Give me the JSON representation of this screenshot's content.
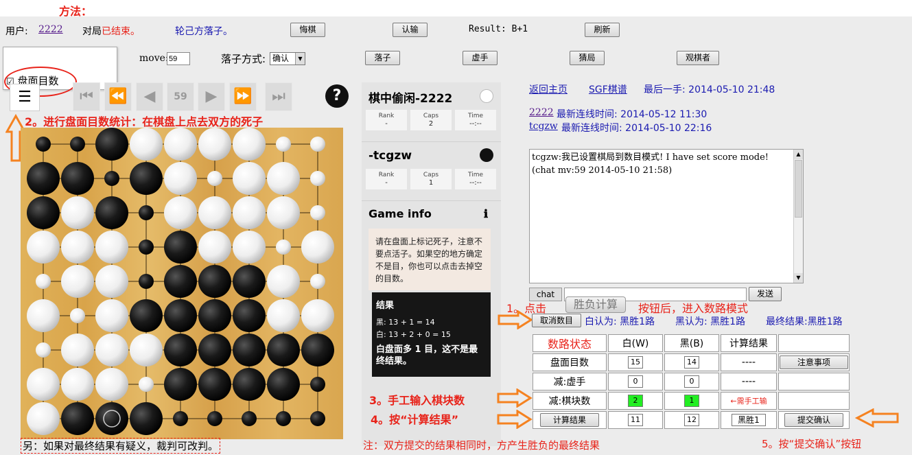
{
  "annotations": {
    "method": "方法：",
    "step2": "2。进行盘面目数统计：在棋盘上点去双方的死子",
    "step1_a": "1。点击",
    "step1_btn": "胜负计算",
    "step1_b": "按钮后，进入数路模式",
    "step3": "3。手工输入棋块数",
    "step4": "4。按“计算结果”",
    "step5": "5。按“提交确认”按钮",
    "note": "注：双方提交的结果相同时，方产生胜负的最终结果",
    "other": "另：如果对最终结果有疑义，裁判可改判。",
    "need_manual": "←需手工输"
  },
  "topbar": {
    "user_label": "用户:",
    "user_name": "2222",
    "game_status_a": "对局",
    "game_status_b": "已结束。",
    "turn": "轮己方落子。",
    "undo_btn": "悔棋",
    "resign_btn": "认输",
    "result": "Result: B+1",
    "refresh_btn": "刷新",
    "move_label": "move:",
    "move_value": "59",
    "place_label": "落子方式:",
    "place_value": "确认",
    "place_btn": "落子",
    "pass_btn": "虚手",
    "guess_btn": "猜局",
    "observer_btn": "观棋者"
  },
  "dropdown": {
    "checkbox_label": "盘面目数",
    "checked": true
  },
  "board_nav": {
    "move_number": "59"
  },
  "players": {
    "white": {
      "name": "棋中偷闲-2222",
      "rank_label": "Rank",
      "rank": "-",
      "caps_label": "Caps",
      "caps": "2",
      "time_label": "Time",
      "time": "--:--"
    },
    "black": {
      "name": "-tcgzw",
      "rank_label": "Rank",
      "rank": "-",
      "caps_label": "Caps",
      "caps": "1",
      "time_label": "Time",
      "time": "--:--"
    }
  },
  "game_info": {
    "title": "Game info",
    "hint": "请在盘面上标记死子，注意不要点活子。如果空的地方确定不是目，你也可以点击去掉空的目数。",
    "result_title": "结果",
    "black_line": "黑: 13 + 1 = 14",
    "white_line": "白: 13 + 2 + 0 = 15",
    "conclusion": "白盘面多 1 目，这不是最终结果。"
  },
  "right": {
    "home_link": "返回主页",
    "sgf_link": "SGF棋谱",
    "last_move": "最后一手: 2014-05-10 21:48",
    "user1": "2222",
    "user1_online": "最新连线时间: 2014-05-12 11:30",
    "user2": "tcgzw",
    "user2_online": "最新连线时间: 2014-05-10 22:16",
    "chat_text": "tcgzw:我已设置棋局到数目模式! I have set score mode! (chat mv:59 2014-05-10 21:58)",
    "chat_tab": "chat",
    "send_btn": "发送",
    "cancel_count_btn": "取消数目",
    "white_claim": "白认为: 黑胜1路",
    "black_claim": "黑认为: 黑胜1路",
    "final_result": "最终结果:黑胜1路"
  },
  "score_table": {
    "header": [
      "数路状态",
      "白(W)",
      "黑(B)",
      "计算结果",
      ""
    ],
    "rows": [
      {
        "label": "盘面目数",
        "w": "15",
        "b": "14",
        "calc": "----",
        "action": "注意事项"
      },
      {
        "label": "减:虚手",
        "w": "0",
        "b": "0",
        "calc": "----",
        "action": ""
      },
      {
        "label": "减:棋块数",
        "w": "2",
        "b": "1",
        "calc": "",
        "action": ""
      },
      {
        "label": "计算结果",
        "w": "11",
        "b": "12",
        "calc": "黑胜1",
        "action": "提交确认"
      }
    ]
  },
  "board": {
    "size": 9,
    "stones": [
      "bbbwwwwww",
      "bbbbwwwww",
      "bwbbwwwww",
      "wwwbbwwww",
      "wwwbbbbww",
      "wwwbbbbww",
      "wwwwbbbbb",
      "wwwwbbbbb",
      "wbbbbbbbb"
    ],
    "small": [
      [
        0,
        0
      ],
      [
        0,
        1
      ],
      [
        0,
        7
      ],
      [
        0,
        8
      ],
      [
        1,
        2
      ],
      [
        1,
        5
      ],
      [
        1,
        8
      ],
      [
        2,
        3
      ],
      [
        2,
        8
      ],
      [
        3,
        3
      ],
      [
        3,
        7
      ],
      [
        4,
        0
      ],
      [
        4,
        3
      ],
      [
        4,
        8
      ],
      [
        5,
        1
      ],
      [
        6,
        0
      ],
      [
        7,
        3
      ],
      [
        7,
        8
      ],
      [
        8,
        4
      ],
      [
        8,
        5
      ],
      [
        8,
        6
      ],
      [
        8,
        7
      ],
      [
        8,
        8
      ]
    ],
    "last_move": [
      8,
      2
    ]
  }
}
